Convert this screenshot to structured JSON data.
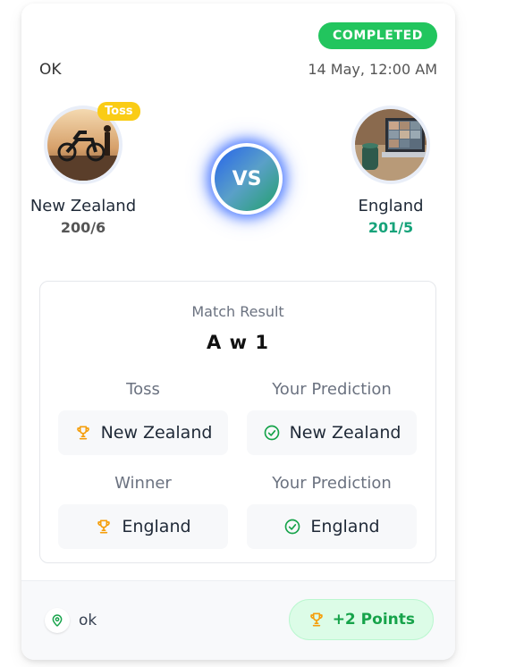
{
  "match": {
    "status": "COMPLETED",
    "venue": "OK",
    "datetime": "14 May, 12:00 AM",
    "toss_badge": "Toss",
    "vs_label": "VS"
  },
  "teams": {
    "left": {
      "name": "New Zealand",
      "score": "200/6"
    },
    "right": {
      "name": "England",
      "score": "201/5"
    }
  },
  "result": {
    "label": "Match Result",
    "value": "A w 1",
    "toss_label": "Toss",
    "toss_value": "New Zealand",
    "toss_prediction_label": "Your Prediction",
    "toss_prediction_value": "New Zealand",
    "winner_label": "Winner",
    "winner_value": "England",
    "winner_prediction_label": "Your Prediction",
    "winner_prediction_value": "England"
  },
  "footer": {
    "venue": "ok",
    "points": "+2 Points"
  },
  "colors": {
    "completed_green": "#22c55e",
    "score_win_green": "#16a37a",
    "toss_yellow": "#facc15",
    "trophy_gold": "#f59e0b",
    "check_green": "#16a34a"
  },
  "icons": [
    "trophy-icon",
    "check-circle-icon",
    "location-pin-icon"
  ]
}
